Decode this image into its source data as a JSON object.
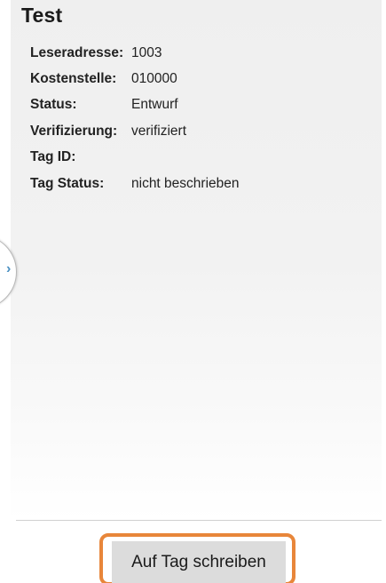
{
  "header": {
    "title": "Test"
  },
  "details": [
    {
      "label": "Leseradresse:",
      "value": "1003"
    },
    {
      "label": "Kostenstelle:",
      "value": "010000"
    },
    {
      "label": "Status:",
      "value": "Entwurf"
    },
    {
      "label": "Verifizierung:",
      "value": "verifiziert"
    },
    {
      "label": "Tag ID:",
      "value": ""
    },
    {
      "label": "Tag Status:",
      "value": "nicht beschrieben"
    }
  ],
  "drawer": {
    "icon": "chevron-right-icon"
  },
  "actions": {
    "write_tag_label": "Auf Tag schreiben"
  },
  "colors": {
    "highlight": "#e8863a",
    "chevron": "#4a90c2",
    "button_bg": "#dcdcdc"
  }
}
